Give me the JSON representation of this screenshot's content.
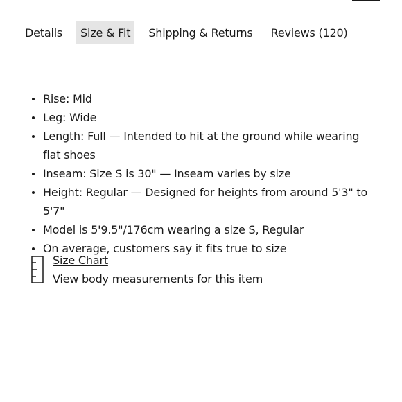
{
  "tabs": [
    {
      "label": "Details",
      "active": false
    },
    {
      "label": "Size & Fit",
      "active": true
    },
    {
      "label": "Shipping & Returns",
      "active": false
    },
    {
      "label": "Reviews (120)",
      "active": false
    }
  ],
  "fit_details": [
    "Rise: Mid",
    "Leg: Wide",
    "Length: Full — Intended to hit at the ground while wearing flat shoes",
    "Inseam: Size S is 30\" — Inseam varies by size",
    "Height: Regular — Designed for heights from around 5'3\" to 5'7\"",
    "Model is 5'9.5\"/176cm wearing a size S, Regular",
    "On average, customers say it fits true to size"
  ],
  "size_chart": {
    "icon": "ruler-icon",
    "link_label": "Size Chart",
    "description": "View body measurements for this item"
  },
  "colors": {
    "text": "#1a1a1a",
    "active_tab_bg": "#e5e5e5",
    "divider": "#ececec"
  }
}
